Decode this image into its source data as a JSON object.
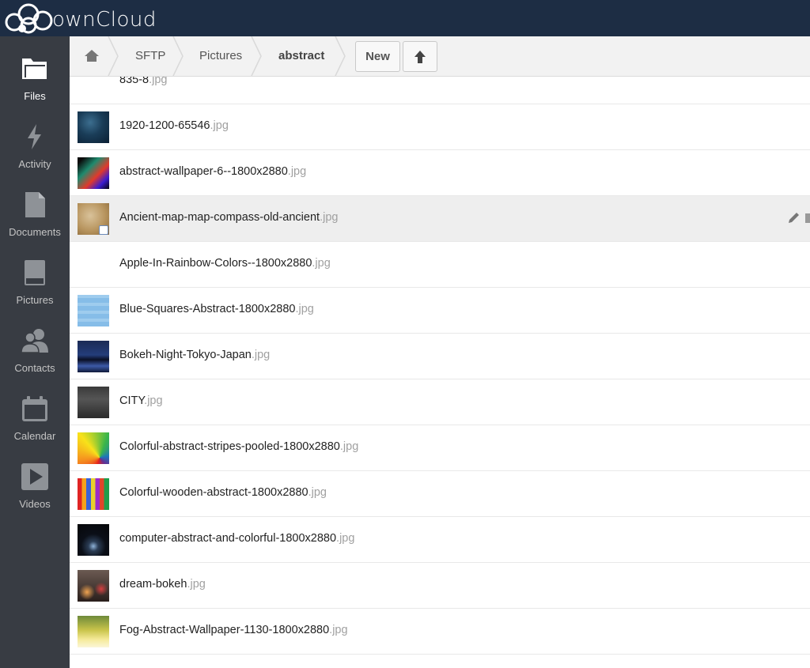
{
  "app": {
    "name": "ownCloud"
  },
  "nav": [
    {
      "label": "Files",
      "icon": "folder-icon",
      "active": true
    },
    {
      "label": "Activity",
      "icon": "lightning-icon",
      "active": false
    },
    {
      "label": "Documents",
      "icon": "document-icon",
      "active": false
    },
    {
      "label": "Pictures",
      "icon": "picture-icon",
      "active": false
    },
    {
      "label": "Contacts",
      "icon": "contacts-icon",
      "active": false
    },
    {
      "label": "Calendar",
      "icon": "calendar-icon",
      "active": false
    },
    {
      "label": "Videos",
      "icon": "play-icon",
      "active": false
    }
  ],
  "breadcrumb": [
    {
      "label": "SFTP"
    },
    {
      "label": "Pictures"
    },
    {
      "label": "abstract"
    }
  ],
  "toolbar": {
    "new_label": "New",
    "upload_icon": "upload-arrow-icon"
  },
  "files": [
    {
      "name": "835-8",
      "ext": ".jpg"
    },
    {
      "name": "1920-1200-65546",
      "ext": ".jpg"
    },
    {
      "name": "abstract-wallpaper-6--1800x2880",
      "ext": ".jpg"
    },
    {
      "name": "Ancient-map-map-compass-old-ancient",
      "ext": ".jpg"
    },
    {
      "name": "Apple-In-Rainbow-Colors--1800x2880",
      "ext": ".jpg"
    },
    {
      "name": "Blue-Squares-Abstract-1800x2880",
      "ext": ".jpg"
    },
    {
      "name": "Bokeh-Night-Tokyo-Japan",
      "ext": ".jpg"
    },
    {
      "name": "CITY",
      "ext": ".jpg"
    },
    {
      "name": "Colorful-abstract-stripes-pooled-1800x2880",
      "ext": ".jpg"
    },
    {
      "name": "Colorful-wooden-abstract-1800x2880",
      "ext": ".jpg"
    },
    {
      "name": "computer-abstract-and-colorful-1800x2880",
      "ext": ".jpg"
    },
    {
      "name": "dream-bokeh",
      "ext": ".jpg"
    },
    {
      "name": "Fog-Abstract-Wallpaper-1130-1800x2880",
      "ext": ".jpg"
    }
  ],
  "colors": {
    "header": "#1d2d44",
    "sidebar": "#383c43",
    "row_highlight": "#eeeeee"
  }
}
